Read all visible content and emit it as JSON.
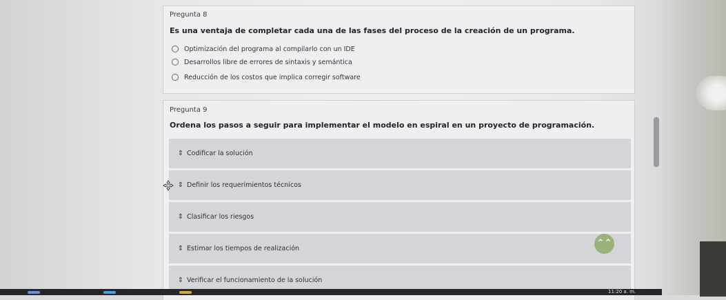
{
  "question8": {
    "number": "Pregunta 8",
    "text": "Es una ventaja de completar cada una de las fases del proceso de la creación de un programa.",
    "options": [
      "Optimización del programa al compilarlo con un IDE",
      "Desarrollos libre de errores de sintaxis y semántica",
      "Reducción de los costos que implica corregir software"
    ]
  },
  "question9": {
    "number": "Pregunta 9",
    "text": "Ordena los pasos a seguir para implementar el modelo en espiral en un proyecto de programación.",
    "items": [
      "Codificar la solución",
      "Definir los requerimientos técnicos",
      "Clasificar los riesgos",
      "Estimar los tiempos de realización",
      "Verificar el funcionamiento de la solución"
    ]
  },
  "icons": {
    "updown": "⇕",
    "scroll_top": "⌃⌃"
  },
  "taskbar": {
    "clock": "11:20 a. m."
  },
  "colors": {
    "scroll_top_button": "#9bb27a",
    "drag_item_bg": "#d4d5d8",
    "taskbar": "#24262b"
  }
}
